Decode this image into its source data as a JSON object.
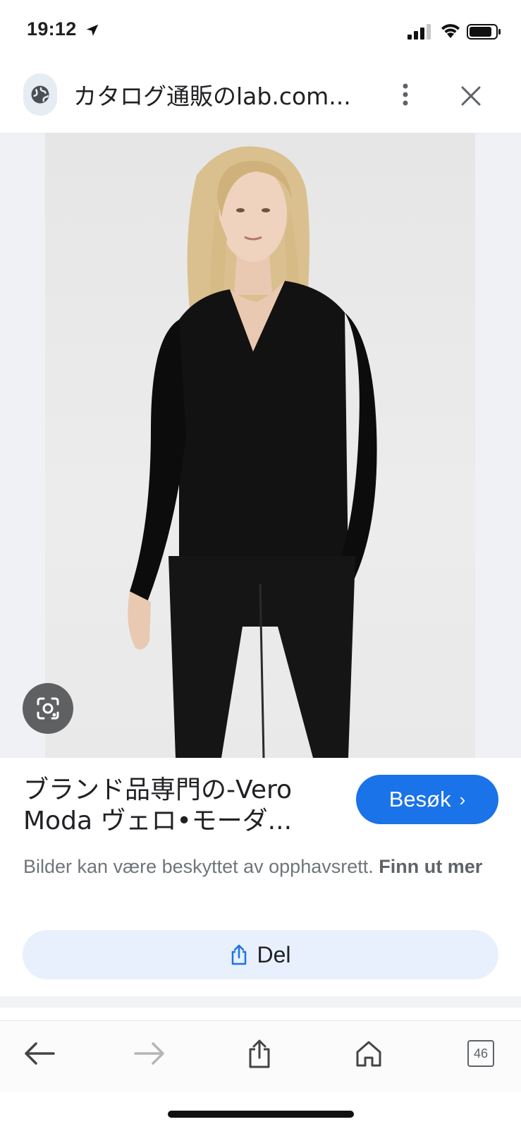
{
  "status_bar": {
    "time": "19:12"
  },
  "toolbar": {
    "title": "カタログ通販のlab.com...",
    "site_icon": "globe-icon",
    "menu_icon": "more-vert-icon",
    "close_icon": "close-icon"
  },
  "image": {
    "lens_icon": "lens-icon"
  },
  "result": {
    "title_line1": "ブランド品専門の-Vero",
    "title_line2": "Moda ヴェロ•モーダ...",
    "visit_label": "Besøk",
    "visit_chevron": "›",
    "copyright_text": "Bilder kan være beskyttet av opphavsrett.",
    "copyright_link": "Finn ut mer",
    "share_label": "Del"
  },
  "bottom_nav": {
    "back_icon": "arrow-back-icon",
    "forward_icon": "arrow-forward-icon",
    "share_icon": "share-icon",
    "home_icon": "home-icon",
    "tabs_count": "46"
  },
  "colors": {
    "accent": "#1a73e8",
    "share_bg": "#e8f0fe",
    "secondary_text": "#70757a",
    "image_backdrop": "#eff1f4"
  }
}
